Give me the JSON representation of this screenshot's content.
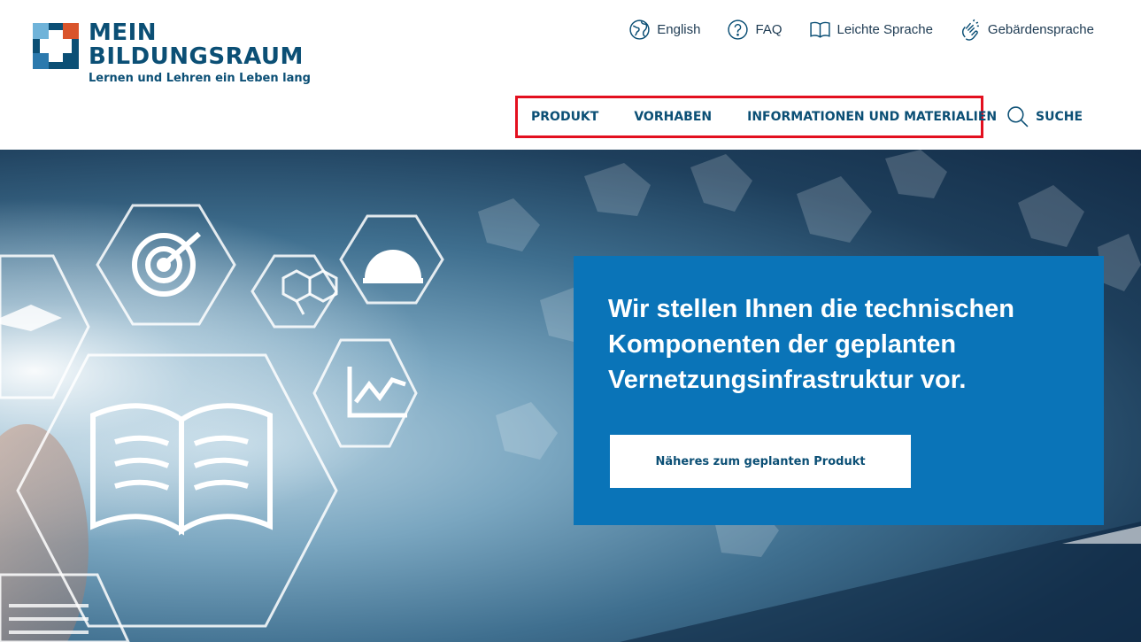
{
  "brand": {
    "name_line1": "MEIN",
    "name_line2": "BILDUNGSRAUM",
    "tagline": "Lernen und Lehren ein Leben lang",
    "colors": {
      "primary": "#0b4f75",
      "accent": "#d9542b",
      "light": "#6fb3d9"
    }
  },
  "utility_nav": [
    {
      "label": "English",
      "icon": "globe-icon"
    },
    {
      "label": "FAQ",
      "icon": "question-icon"
    },
    {
      "label": "Leichte Sprache",
      "icon": "book-icon"
    },
    {
      "label": "Gebärdensprache",
      "icon": "sign-language-icon"
    }
  ],
  "main_nav": {
    "items": [
      "PRODUKT",
      "VORHABEN",
      "INFORMATIONEN UND MATERIALIEN"
    ],
    "highlight_color": "#e3101f"
  },
  "search": {
    "label": "SUCHE",
    "icon": "search-icon"
  },
  "hero": {
    "headline": "Wir stellen Ihnen die technischen Kom­ponenten der geplanten Vernetzungsin­frastruktur vor.",
    "cta_label": "Näheres zum geplanten Produkt",
    "panel_color": "#0a74b8"
  }
}
